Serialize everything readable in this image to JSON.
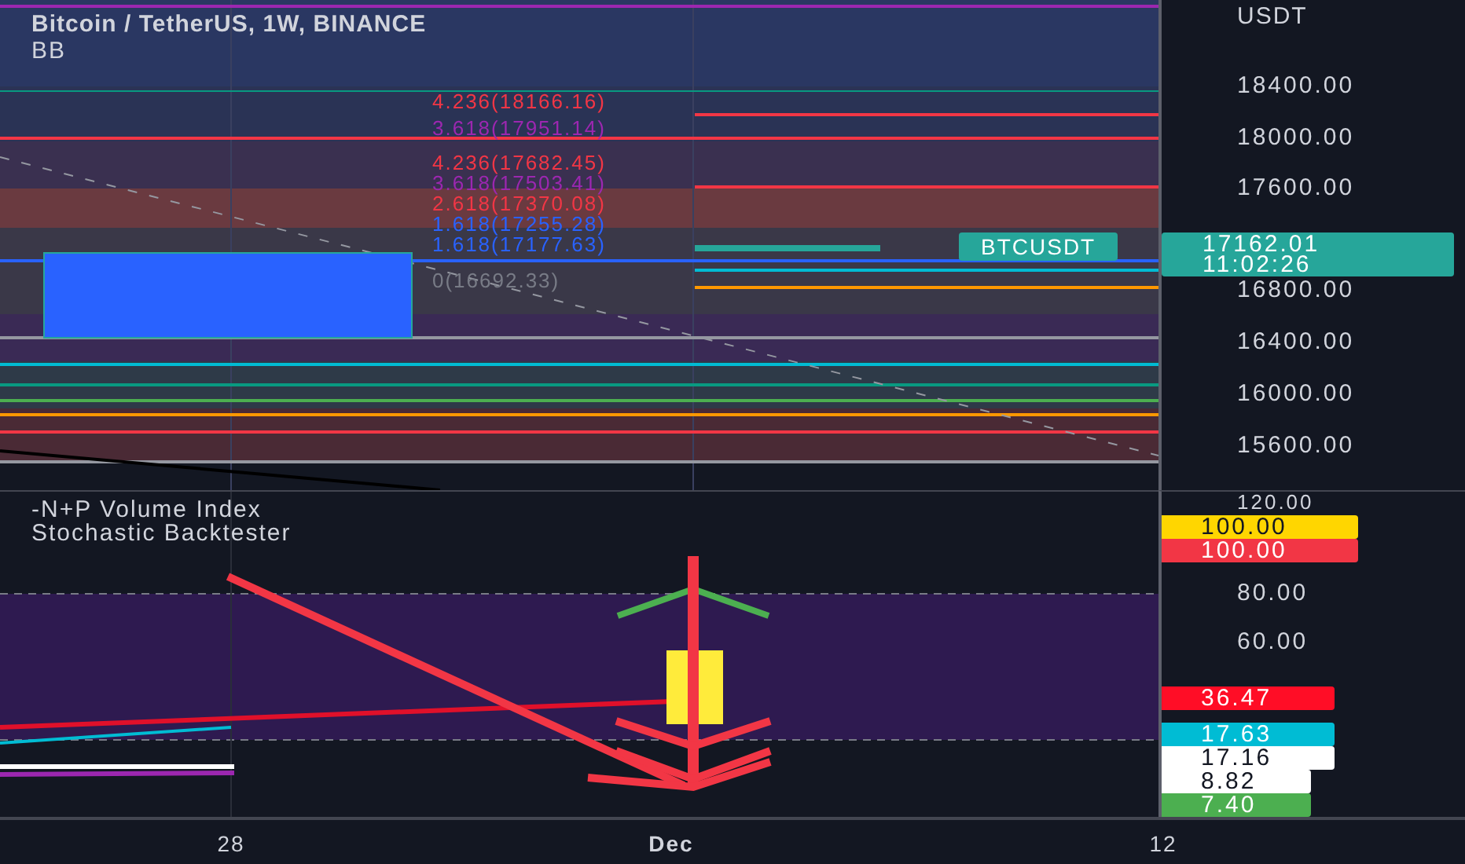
{
  "header": {
    "title": "Bitcoin / TetherUS, 1W, BINANCE",
    "indicator": "BB"
  },
  "fib_labels": [
    {
      "text": "4.236(18166.16)",
      "color": "#f23645"
    },
    {
      "text": "3.618(17951.14)",
      "color": "#9c27b0"
    },
    {
      "text": "4.236(17682.45)",
      "color": "#f23645"
    },
    {
      "text": "3.618(17503.41)",
      "color": "#9c27b0"
    },
    {
      "text": "2.618(17370.08)",
      "color": "#f23645"
    },
    {
      "text": "1.618(17255.28)",
      "color": "#2962ff"
    },
    {
      "text": "1.618(17177.63)",
      "color": "#2962ff"
    },
    {
      "text": "0(16692.33)",
      "color": "#787b86"
    }
  ],
  "price_axis": {
    "unit": "USDT",
    "ticks": [
      "18400.00",
      "18000.00",
      "17600.00",
      "16800.00",
      "16400.00",
      "16000.00",
      "15600.00"
    ]
  },
  "last_price": {
    "symbol": "BTCUSDT",
    "price": "17162.01",
    "countdown": "11:02:26"
  },
  "lower_pane": {
    "indicators": [
      "-N+P Volume Index",
      "Stochastic Backtester"
    ],
    "ticks": [
      "120.00",
      "80.00",
      "60.00"
    ],
    "value_tags": [
      {
        "text": "100.00",
        "color": "#ffd600"
      },
      {
        "text": "100.00",
        "color": "#f23645"
      },
      {
        "text": "36.47",
        "color": "#ff0d26"
      },
      {
        "text": "17.63",
        "color": "#00bcd4"
      },
      {
        "text": "17.16",
        "color": "#ffffff"
      },
      {
        "text": "8.82",
        "color": "#ffffff"
      },
      {
        "text": "7.40",
        "color": "#4caf50"
      }
    ]
  },
  "time_axis": [
    "28",
    "Dec",
    "12"
  ]
}
